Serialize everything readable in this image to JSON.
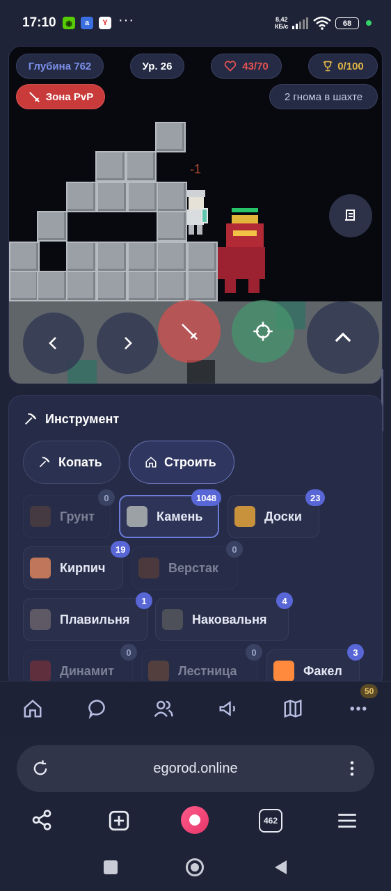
{
  "status": {
    "time": "17:10",
    "speed_value": "8,42",
    "speed_unit": "КБ/с",
    "battery": "68",
    "app_icons": [
      "duolingo-icon",
      "vpn-icon",
      "yandex-icon"
    ]
  },
  "game": {
    "depth": "Глубина 762",
    "level": "Ур. 26",
    "health": "43/70",
    "trophy": "0/100",
    "pvp": "Зона PvP",
    "miners": "2 гнома в шахте",
    "damage": "-1"
  },
  "panel": {
    "title": "Инструмент",
    "modes": [
      {
        "label": "Копать"
      },
      {
        "label": "Строить"
      }
    ],
    "items": [
      {
        "label": "Грунт",
        "count": "0",
        "color": "#6b4a3c"
      },
      {
        "label": "Камень",
        "count": "1048",
        "color": "#9ca1a6"
      },
      {
        "label": "Доски",
        "count": "23",
        "color": "#c8913c"
      },
      {
        "label": "Кирпич",
        "count": "19",
        "color": "#c0765a"
      },
      {
        "label": "Верстак",
        "count": "0",
        "color": "#7a4a34"
      },
      {
        "label": "Плавильня",
        "count": "1",
        "color": "#5f5865"
      },
      {
        "label": "Наковальня",
        "count": "4",
        "color": "#4d5058"
      },
      {
        "label": "Динамит",
        "count": "0",
        "color": "#a83434"
      },
      {
        "label": "Лестница",
        "count": "0",
        "color": "#8a5a34"
      },
      {
        "label": "Факел",
        "count": "3",
        "color": "#ff8a3d"
      }
    ]
  },
  "nav": {
    "badge": "50"
  },
  "browser": {
    "url": "egorod.online",
    "tabs": "462"
  }
}
